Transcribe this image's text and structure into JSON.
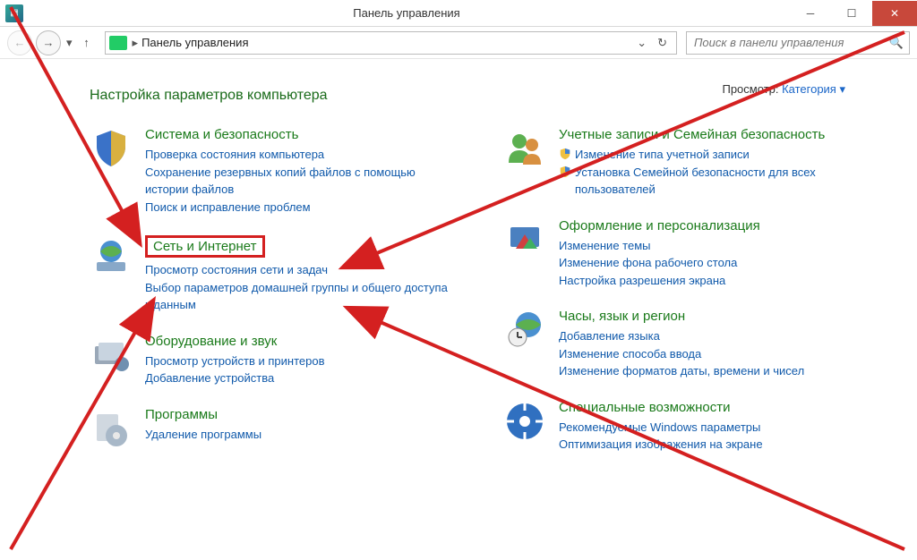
{
  "window": {
    "title": "Панель управления"
  },
  "toolbar": {
    "breadcrumb": "Панель управления",
    "search_placeholder": "Поиск в панели управления"
  },
  "content": {
    "heading": "Настройка параметров компьютера",
    "view_label": "Просмотр:",
    "view_value": "Категория"
  },
  "categories": {
    "system": {
      "title": "Система и безопасность",
      "links": [
        "Проверка состояния компьютера",
        "Сохранение резервных копий файлов с помощью истории файлов",
        "Поиск и исправление проблем"
      ]
    },
    "network": {
      "title": "Сеть и Интернет",
      "links": [
        "Просмотр состояния сети и задач",
        "Выбор параметров домашней группы и общего доступа к данным"
      ]
    },
    "hardware": {
      "title": "Оборудование и звук",
      "links": [
        "Просмотр устройств и принтеров",
        "Добавление устройства"
      ]
    },
    "programs": {
      "title": "Программы",
      "links": [
        "Удаление программы"
      ]
    },
    "users": {
      "title": "Учетные записи и Семейная безопасность",
      "links": [
        "Изменение типа учетной записи",
        "Установка Семейной безопасности для всех пользователей"
      ]
    },
    "appearance": {
      "title": "Оформление и персонализация",
      "links": [
        "Изменение темы",
        "Изменение фона рабочего стола",
        "Настройка разрешения экрана"
      ]
    },
    "clock": {
      "title": "Часы, язык и регион",
      "links": [
        "Добавление языка",
        "Изменение способа ввода",
        "Изменение форматов даты, времени и чисел"
      ]
    },
    "access": {
      "title": "Специальные возможности",
      "links": [
        "Рекомендуемые Windows параметры",
        "Оптимизация изображения на экране"
      ]
    }
  }
}
